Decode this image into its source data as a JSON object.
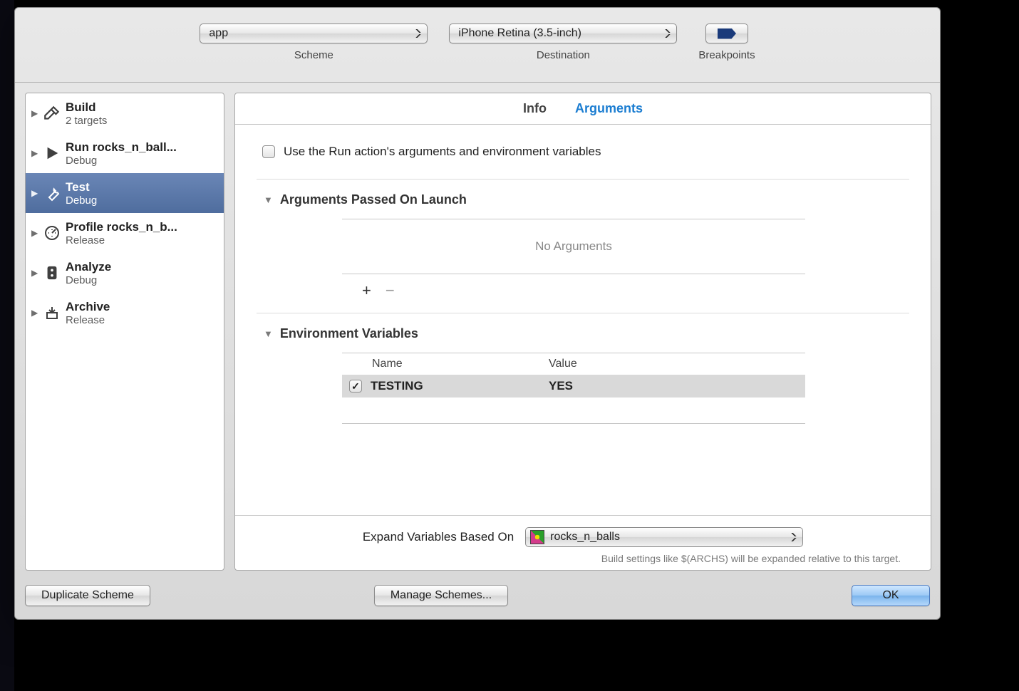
{
  "header": {
    "scheme_value": "app",
    "scheme_label": "Scheme",
    "destination_value": "iPhone Retina (3.5-inch)",
    "destination_label": "Destination",
    "breakpoints_label": "Breakpoints"
  },
  "sidebar": {
    "items": [
      {
        "title": "Build",
        "sub": "2 targets"
      },
      {
        "title": "Run rocks_n_ball...",
        "sub": "Debug"
      },
      {
        "title": "Test",
        "sub": "Debug"
      },
      {
        "title": "Profile rocks_n_b...",
        "sub": "Release"
      },
      {
        "title": "Analyze",
        "sub": "Debug"
      },
      {
        "title": "Archive",
        "sub": "Release"
      }
    ]
  },
  "tabs": {
    "info": "Info",
    "arguments": "Arguments"
  },
  "content": {
    "use_run_action_label": "Use the Run action's arguments and environment variables",
    "arguments_section_title": "Arguments Passed On Launch",
    "no_arguments": "No Arguments",
    "env_section_title": "Environment Variables",
    "env_cols": {
      "name": "Name",
      "value": "Value"
    },
    "env_rows": [
      {
        "checked": true,
        "name": "TESTING",
        "value": "YES"
      }
    ],
    "expand_label": "Expand Variables Based On",
    "expand_value": "rocks_n_balls",
    "expand_hint": "Build settings like $(ARCHS) will be expanded relative to this target."
  },
  "footer": {
    "duplicate": "Duplicate Scheme",
    "manage": "Manage Schemes...",
    "ok": "OK"
  }
}
